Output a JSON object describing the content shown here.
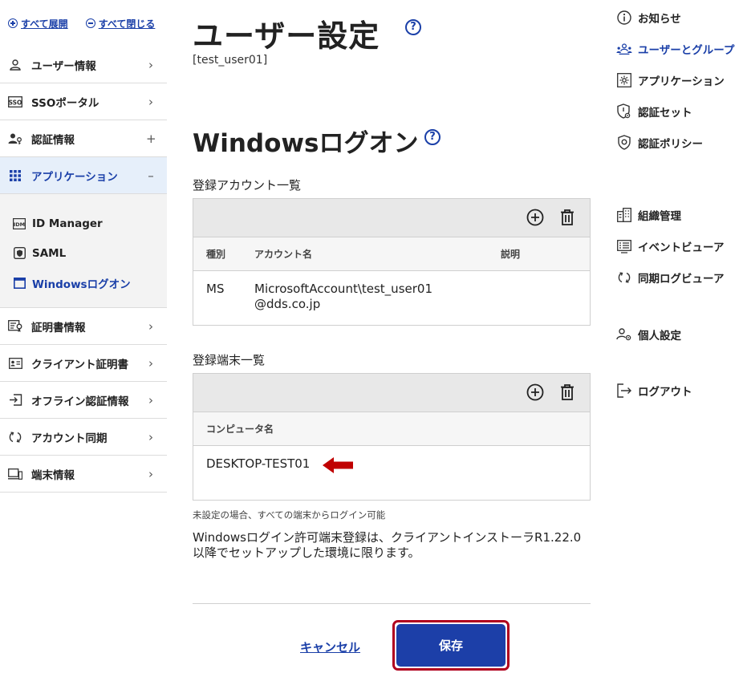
{
  "sidebar": {
    "expand_all": "すべて展開",
    "collapse_all": "すべて閉じる",
    "items": [
      {
        "label": "ユーザー情報",
        "icon": "user-icon"
      },
      {
        "label": "SSOポータル",
        "icon": "sso-icon"
      },
      {
        "label": "認証情報",
        "icon": "user-key-icon"
      },
      {
        "label": "アプリケーション",
        "icon": "grid-icon"
      },
      {
        "label": "証明書情報",
        "icon": "certificate-icon"
      },
      {
        "label": "クライアント証明書",
        "icon": "id-card-icon"
      },
      {
        "label": "オフライン認証情報",
        "icon": "sign-in-icon"
      },
      {
        "label": "アカウント同期",
        "icon": "sync-icon"
      },
      {
        "label": "端末情報",
        "icon": "device-icon"
      }
    ],
    "sub_items": [
      {
        "label": "ID Manager",
        "icon": "idm-icon"
      },
      {
        "label": "SAML",
        "icon": "shield-box-icon"
      },
      {
        "label": "Windowsログオン",
        "icon": "window-icon"
      }
    ]
  },
  "main": {
    "title": "ユーザー設定",
    "user_id": "[test_user01]",
    "section_title": "Windowsログオン",
    "accounts": {
      "label": "登録アカウント一覧",
      "columns": [
        "種別",
        "アカウント名",
        "説明"
      ],
      "rows": [
        {
          "type": "MS",
          "name_line1": "MicrosoftAccount\\test_user01",
          "name_line2": "@dds.co.jp",
          "description": ""
        }
      ]
    },
    "terminals": {
      "label": "登録端末一覧",
      "columns": [
        "コンピュータ名"
      ],
      "rows": [
        {
          "name": "DESKTOP-TEST01"
        }
      ]
    },
    "note_small": "未設定の場合、すべての端末からログイン可能",
    "note_main": "Windowsログイン許可端末登録は、クライアントインストーラR1.22.0以降でセットアップした環境に限ります。",
    "cancel_label": "キャンセル",
    "save_label": "保存"
  },
  "right_nav": {
    "items": [
      {
        "label": "お知らせ",
        "icon": "info-icon"
      },
      {
        "label": "ユーザーとグループ",
        "icon": "users-group-icon"
      },
      {
        "label": "アプリケーション",
        "icon": "app-gear-icon"
      },
      {
        "label": "認証セット",
        "icon": "shield-gear-icon"
      },
      {
        "label": "認証ポリシー",
        "icon": "shield-policy-icon"
      },
      {
        "label": "組織管理",
        "icon": "building-icon"
      },
      {
        "label": "イベントビューア",
        "icon": "event-list-icon"
      },
      {
        "label": "同期ログビューア",
        "icon": "sync-log-icon"
      },
      {
        "label": "個人設定",
        "icon": "user-settings-icon"
      },
      {
        "label": "ログアウト",
        "icon": "logout-icon"
      }
    ]
  },
  "colors": {
    "accent": "#1a3fa8",
    "active_bg": "#e6effa",
    "save_outline": "#b0001e",
    "arrow": "#c00000"
  }
}
